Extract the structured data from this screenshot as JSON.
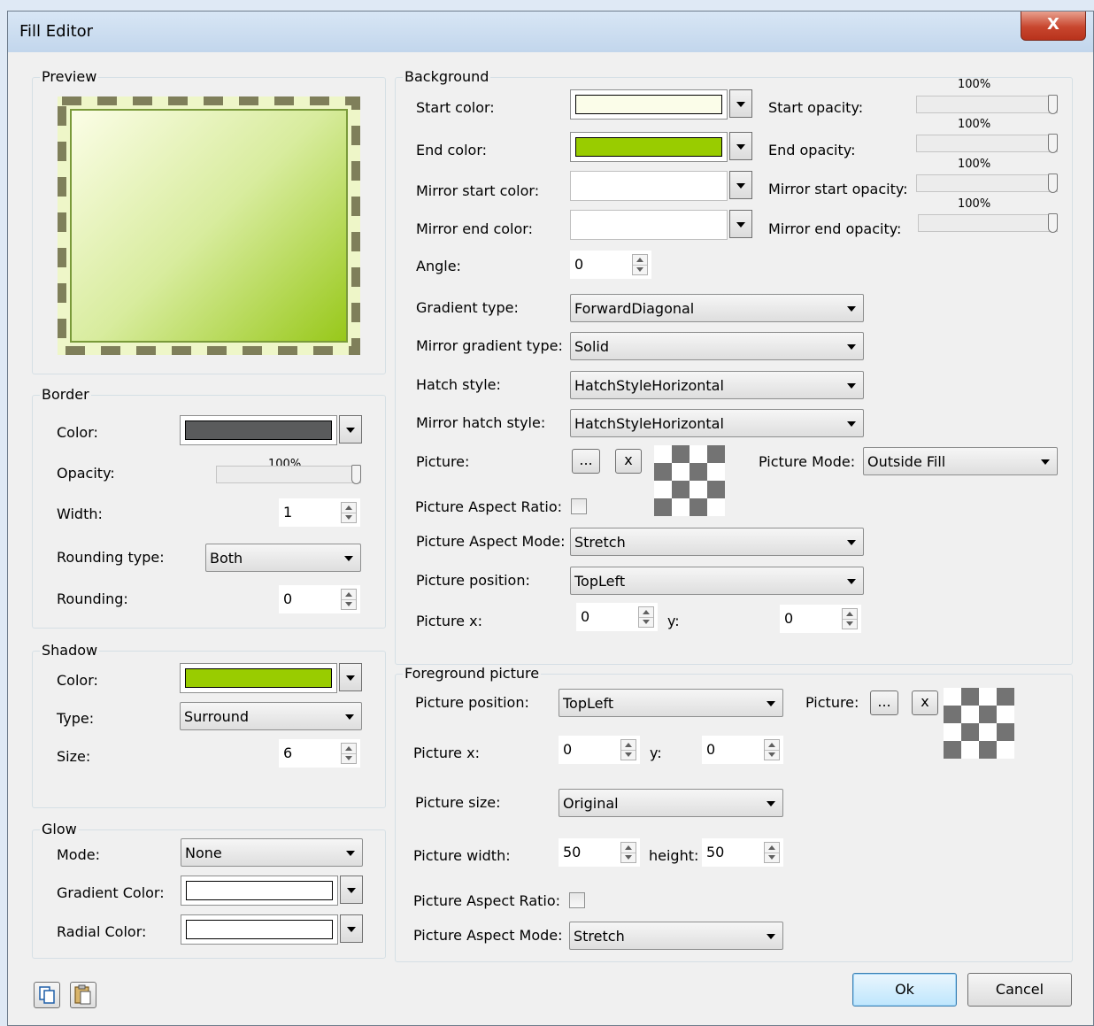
{
  "window": {
    "title": "Fill Editor",
    "close_label": "X"
  },
  "preview": {
    "label": "Preview"
  },
  "border": {
    "label": "Border",
    "color_label": "Color:",
    "color": "#5a5b5c",
    "opacity_label": "Opacity:",
    "opacity_value": "100%",
    "width_label": "Width:",
    "width_value": "1",
    "rounding_type_label": "Rounding type:",
    "rounding_type_value": "Both",
    "rounding_label": "Rounding:",
    "rounding_value": "0"
  },
  "shadow": {
    "label": "Shadow",
    "color_label": "Color:",
    "color": "#99cc00",
    "type_label": "Type:",
    "type_value": "Surround",
    "size_label": "Size:",
    "size_value": "6"
  },
  "glow": {
    "label": "Glow",
    "mode_label": "Mode:",
    "mode_value": "None",
    "gradient_color_label": "Gradient Color:",
    "gradient_color": "#ffffff",
    "radial_color_label": "Radial Color:",
    "radial_color": "#ffffff"
  },
  "background": {
    "label": "Background",
    "start_color_label": "Start color:",
    "start_color": "#fbfde9",
    "end_color_label": "End color:",
    "end_color": "#99cc00",
    "mirror_start_color_label": "Mirror start color:",
    "mirror_start_color": "#ffffff",
    "mirror_end_color_label": "Mirror end color:",
    "mirror_end_color": "#ffffff",
    "start_opacity_label": "Start opacity:",
    "start_opacity_value": "100%",
    "end_opacity_label": "End opacity:",
    "end_opacity_value": "100%",
    "mirror_start_opacity_label": "Mirror start opacity:",
    "mirror_start_opacity_value": "100%",
    "mirror_end_opacity_label": "Mirror end opacity:",
    "mirror_end_opacity_value": "100%",
    "angle_label": "Angle:",
    "angle_value": "0",
    "gradient_type_label": "Gradient type:",
    "gradient_type_value": "ForwardDiagonal",
    "mirror_gradient_type_label": "Mirror gradient type:",
    "mirror_gradient_type_value": "Solid",
    "hatch_style_label": "Hatch style:",
    "hatch_style_value": "HatchStyleHorizontal",
    "mirror_hatch_style_label": "Mirror hatch style:",
    "mirror_hatch_style_value": "HatchStyleHorizontal",
    "picture_label": "Picture:",
    "browse_label": "...",
    "clear_label": "x",
    "picture_mode_label": "Picture Mode:",
    "picture_mode_value": "Outside Fill",
    "aspect_ratio_label": "Picture Aspect Ratio:",
    "aspect_mode_label": "Picture Aspect Mode:",
    "aspect_mode_value": "Stretch",
    "position_label": "Picture position:",
    "position_value": "TopLeft",
    "x_label": "Picture x:",
    "x_value": "0",
    "y_label": "y:",
    "y_value": "0"
  },
  "foreground": {
    "label": "Foreground picture",
    "position_label": "Picture position:",
    "position_value": "TopLeft",
    "picture_label": "Picture:",
    "browse_label": "...",
    "clear_label": "x",
    "x_label": "Picture x:",
    "x_value": "0",
    "y_label": "y:",
    "y_value": "0",
    "size_label": "Picture size:",
    "size_value": "Original",
    "width_label": "Picture width:",
    "width_value": "50",
    "height_label": "height:",
    "height_value": "50",
    "aspect_ratio_label": "Picture Aspect Ratio:",
    "aspect_mode_label": "Picture Aspect Mode:",
    "aspect_mode_value": "Stretch"
  },
  "footer": {
    "ok_label": "Ok",
    "cancel_label": "Cancel",
    "copy_icon": "copy-icon",
    "paste_icon": "paste-icon"
  }
}
